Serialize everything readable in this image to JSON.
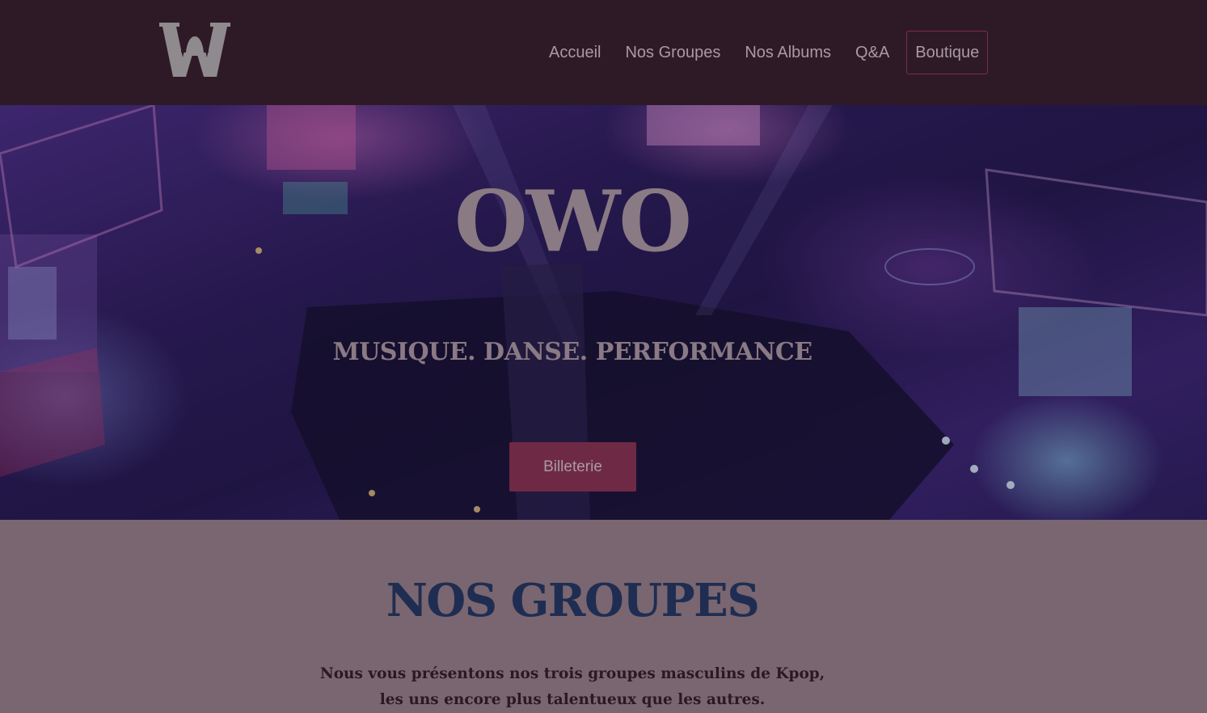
{
  "header": {
    "logo_alt": "OWO logo",
    "nav": [
      {
        "label": "Accueil"
      },
      {
        "label": "Nos Groupes"
      },
      {
        "label": "Nos Albums"
      },
      {
        "label": "Q&A"
      },
      {
        "label": "Boutique"
      }
    ]
  },
  "hero": {
    "title": "OWO",
    "tagline": "MUSIQUE. DANSE. PERFORMANCE",
    "button_label": "Billeterie"
  },
  "groups": {
    "title": "NOS GROUPES",
    "intro_line1": "Nous vous présentons nos trois groupes masculins de Kpop,",
    "intro_line2": "les uns encore plus talentueux que les autres."
  },
  "colors": {
    "header_bg": "#2e1a26",
    "nav_text": "#a79aa2",
    "accent": "#6e2a45",
    "section_bg": "#796670",
    "section_title": "#1f2d52"
  }
}
